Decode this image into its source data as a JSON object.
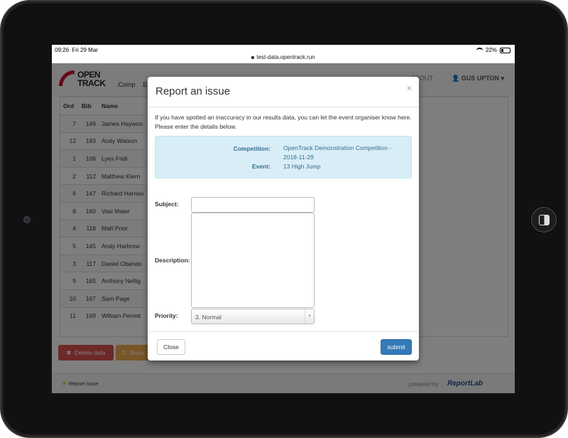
{
  "status_bar": {
    "time": "09:26",
    "date": "Fri 29 Mar",
    "battery": "22%"
  },
  "browser": {
    "url": "test-data.opentrack.run"
  },
  "navbar": {
    "logo_line1": "OPEN",
    "logo_line2": "TRACK",
    "links": [
      ".Comp",
      ".E"
    ],
    "about": "ABOUT",
    "user": "GUS UPTON"
  },
  "table": {
    "headers": [
      "Ord",
      "Bib",
      "Name"
    ],
    "rows": [
      {
        "ord": "7",
        "bib": "149",
        "name": "James Haywoo"
      },
      {
        "ord": "12",
        "bib": "183",
        "name": "Andy Watson"
      },
      {
        "ord": "1",
        "bib": "106",
        "name": "Lyes Fridi"
      },
      {
        "ord": "2",
        "bib": "112",
        "name": "Matthew Kiern"
      },
      {
        "ord": "6",
        "bib": "147",
        "name": "Richard Harriso"
      },
      {
        "ord": "8",
        "bib": "160",
        "name": "Vasi Maier"
      },
      {
        "ord": "4",
        "bib": "118",
        "name": "Matt Prior"
      },
      {
        "ord": "5",
        "bib": "145",
        "name": "Andy Harbrow"
      },
      {
        "ord": "3",
        "bib": "117",
        "name": "Daniel Obando"
      },
      {
        "ord": "9",
        "bib": "165",
        "name": "Anthony Nellig"
      },
      {
        "ord": "10",
        "bib": "167",
        "name": "Sam Page"
      },
      {
        "ord": "11",
        "bib": "169",
        "name": "William Perrett"
      }
    ]
  },
  "buttons": {
    "delete": "Delete data",
    "rename": "Renu"
  },
  "footer": {
    "report_issue": "Report issue",
    "powered_by": "powered by",
    "brand": "ReportLab"
  },
  "modal": {
    "title": "Report an issue",
    "close_x": "×",
    "intro": "If you have spotted an inaccuracy in our results data, you can let the event organiser know here. Please enter the details below.",
    "competition_label": "Competition:",
    "competition_value": "OpenTrack Demonstration Competition - 2018-11-29",
    "event_label": "Event:",
    "event_value": "13 High Jump",
    "subject_label": "Subject:",
    "description_label": "Description:",
    "priority_label": "Priority:",
    "priority_value": "3. Normal",
    "close_button": "Close",
    "submit_button": "submit"
  },
  "colors": {
    "danger": "#d9534f",
    "warning": "#f0ad4e",
    "primary": "#337ab7",
    "info_bg": "#d9edf7",
    "brand_red": "#c8102e"
  }
}
